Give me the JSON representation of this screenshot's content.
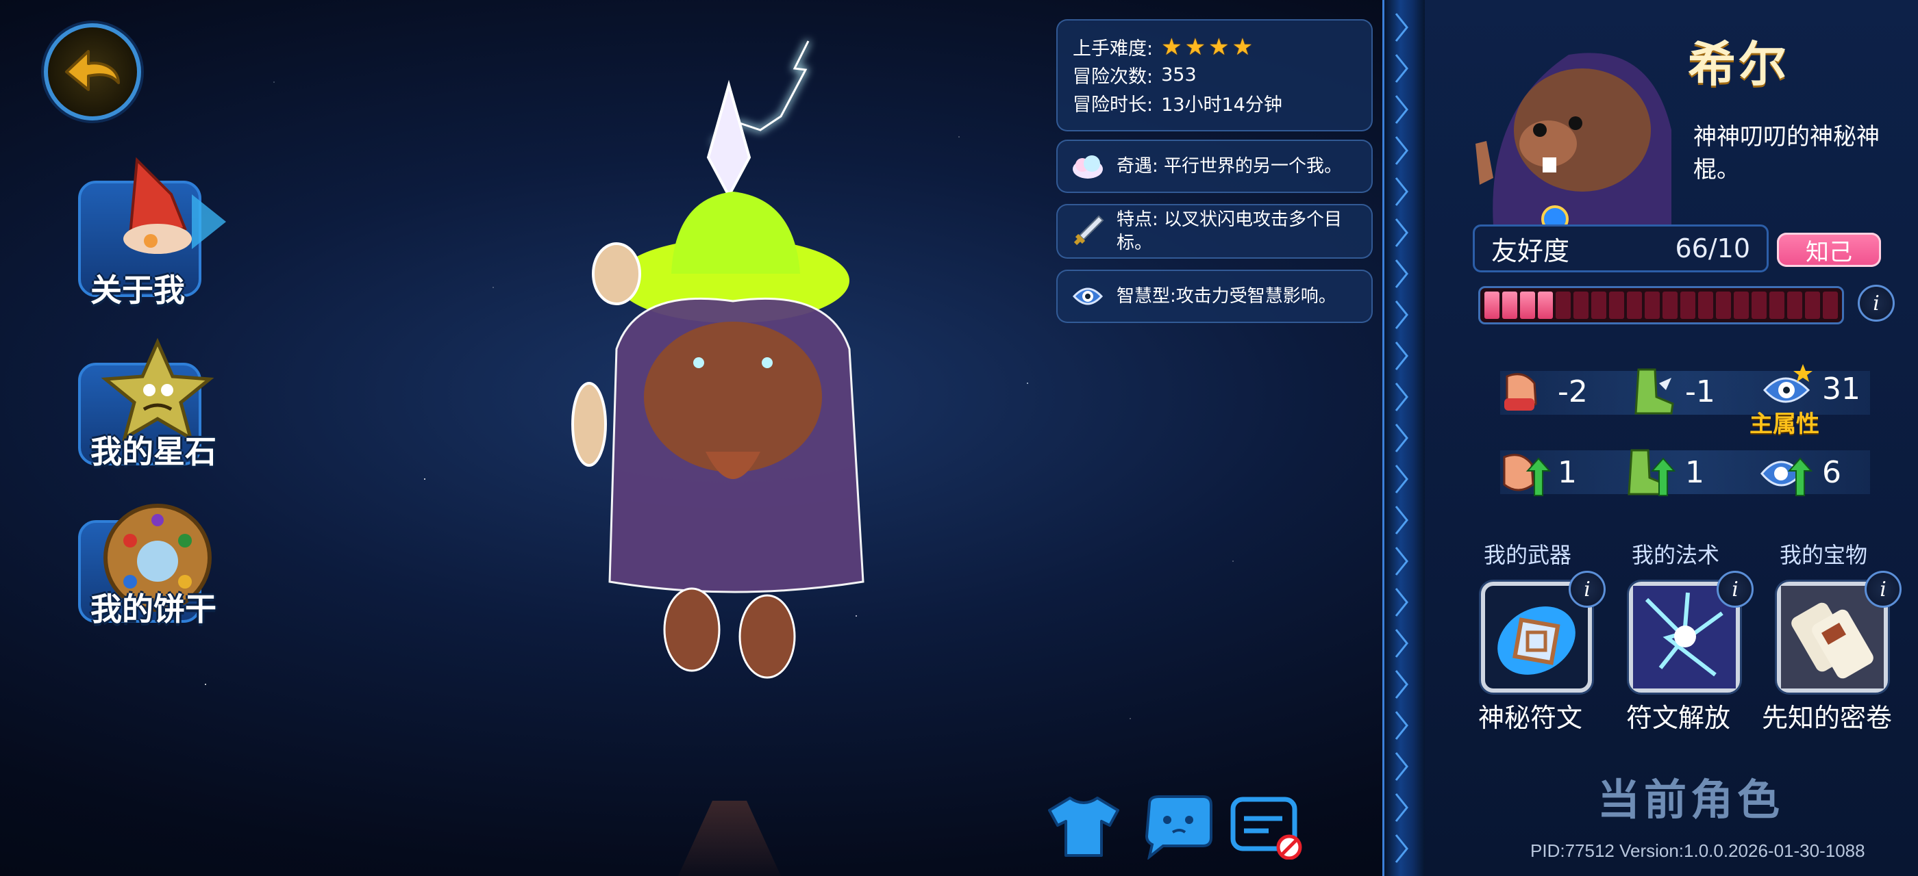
{
  "nav": {
    "items": [
      {
        "label": "关于我"
      },
      {
        "label": "我的星石"
      },
      {
        "label": "我的饼干"
      }
    ]
  },
  "stats": {
    "difficulty_label": "上手难度:",
    "difficulty_stars": 4,
    "adventures_label": "冒险次数:",
    "adventures_value": "353",
    "duration_label": "冒险时长:",
    "duration_value": "13小时14分钟"
  },
  "traits": [
    {
      "text": "奇遇: 平行世界的另一个我。",
      "icon": "cloud-icon"
    },
    {
      "text": "特点: 以叉状闪电攻击多个目标。",
      "icon": "sword-icon"
    },
    {
      "text": "智慧型:攻击力受智慧影响。",
      "icon": "eye-icon"
    }
  ],
  "character": {
    "name": "希尔",
    "description": "神神叨叨的神秘神棍。"
  },
  "friendship": {
    "label": "友好度",
    "value": "66/10",
    "tag": "知己",
    "filled_segments": 4,
    "total_segments": 20
  },
  "attributes": {
    "row1": [
      {
        "icon": "fist-icon",
        "value": "-2"
      },
      {
        "icon": "boot-icon",
        "value": "-1"
      },
      {
        "icon": "eye-icon",
        "value": "31"
      }
    ],
    "row2": [
      {
        "icon": "fist-up-icon",
        "value": "1"
      },
      {
        "icon": "boot-up-icon",
        "value": "1"
      },
      {
        "icon": "eye-up-icon",
        "value": "6"
      }
    ],
    "main_attr_label": "主属性"
  },
  "equipment": [
    {
      "category": "我的武器",
      "name": "神秘符文"
    },
    {
      "category": "我的法术",
      "name": "符文解放"
    },
    {
      "category": "我的宝物",
      "name": "先知的密卷"
    }
  ],
  "current_role": "当前角色",
  "build_info": "PID:77512  Version:1.0.0.2026-01-30-1088",
  "colors": {
    "accent_blue": "#2f7fd8",
    "star_gold": "#ffb820",
    "friend_pink": "#f0508d",
    "main_attr_gold": "#ffc21a"
  }
}
